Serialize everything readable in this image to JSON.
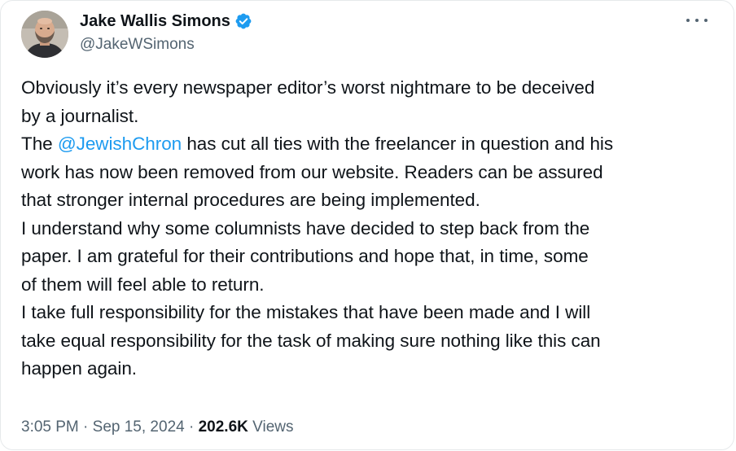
{
  "author": {
    "display_name": "Jake Wallis Simons",
    "handle": "@JakeWSimons",
    "verified": true
  },
  "tweet": {
    "paragraphs": [
      {
        "lines": [
          [
            {
              "text": "Obviously it’s every newspaper editor’s worst nightmare to be deceived"
            }
          ],
          [
            {
              "text": "by a journalist."
            }
          ]
        ]
      },
      {
        "lines": [
          [
            {
              "text": "The "
            },
            {
              "text": "@JewishChron",
              "mention": true
            },
            {
              "text": " has cut all ties with the freelancer in question and his"
            }
          ],
          [
            {
              "text": "work has now been removed from our website. Readers can be assured"
            }
          ],
          [
            {
              "text": "that stronger internal procedures are being implemented."
            }
          ]
        ]
      },
      {
        "lines": [
          [
            {
              "text": "I understand why some columnists have decided to step back from the"
            }
          ],
          [
            {
              "text": "paper. I am grateful for their contributions and hope that, in time, some"
            }
          ],
          [
            {
              "text": "of them will feel able to return."
            }
          ]
        ]
      },
      {
        "lines": [
          [
            {
              "text": "I take full responsibility for the mistakes that have been made and I will"
            }
          ],
          [
            {
              "text": "take equal responsibility for the task of making sure nothing like this can"
            }
          ],
          [
            {
              "text": "happen again."
            }
          ]
        ]
      }
    ]
  },
  "meta": {
    "time": "3:05 PM",
    "separator": " · ",
    "date": "Sep 15, 2024",
    "views_count": "202.6K",
    "views_label": "Views"
  },
  "icons": {
    "verified": "verified-badge-icon",
    "more": "more-options-icon"
  },
  "colors": {
    "accent": "#1d9bf0",
    "text": "#0f1419",
    "secondary": "#536471",
    "border": "#e6e9eb"
  }
}
